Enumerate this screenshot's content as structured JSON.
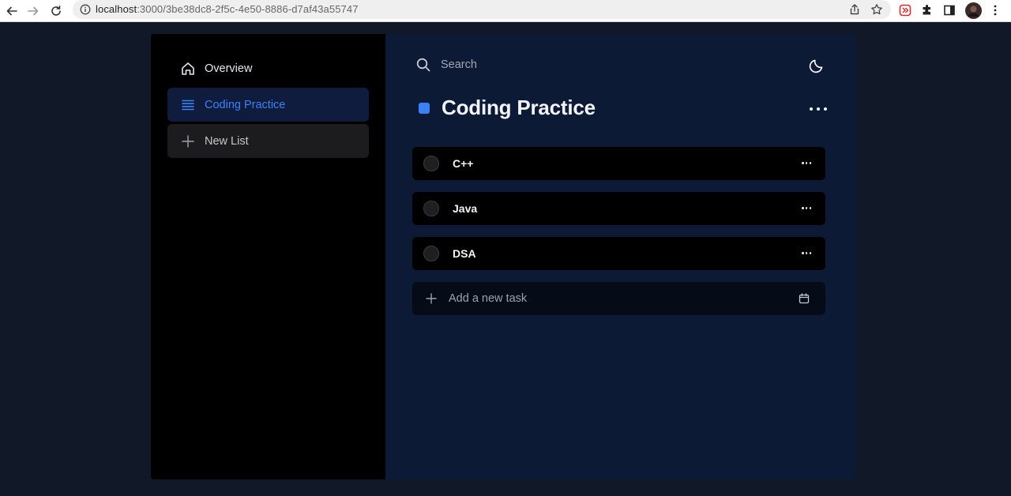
{
  "browser": {
    "url_host": "localhost",
    "url_path": ":3000/3be38dc8-2f5c-4e50-8886-d7af43a55747"
  },
  "sidebar": {
    "items": [
      {
        "label": "Overview",
        "icon": "home-icon"
      },
      {
        "label": "Coding Practice",
        "icon": "list-icon",
        "active": true
      },
      {
        "label": "New List",
        "icon": "plus-icon"
      }
    ]
  },
  "search": {
    "placeholder": "Search"
  },
  "list": {
    "title": "Coding Practice",
    "color": "#3b82f6",
    "tasks": [
      {
        "name": "C++"
      },
      {
        "name": "Java"
      },
      {
        "name": "DSA"
      }
    ],
    "add_placeholder": "Add a new task"
  },
  "colors": {
    "accent": "#3b82f6",
    "sidebar_bg": "#000000",
    "main_bg": "#0c1a35",
    "page_bg": "#111827"
  }
}
